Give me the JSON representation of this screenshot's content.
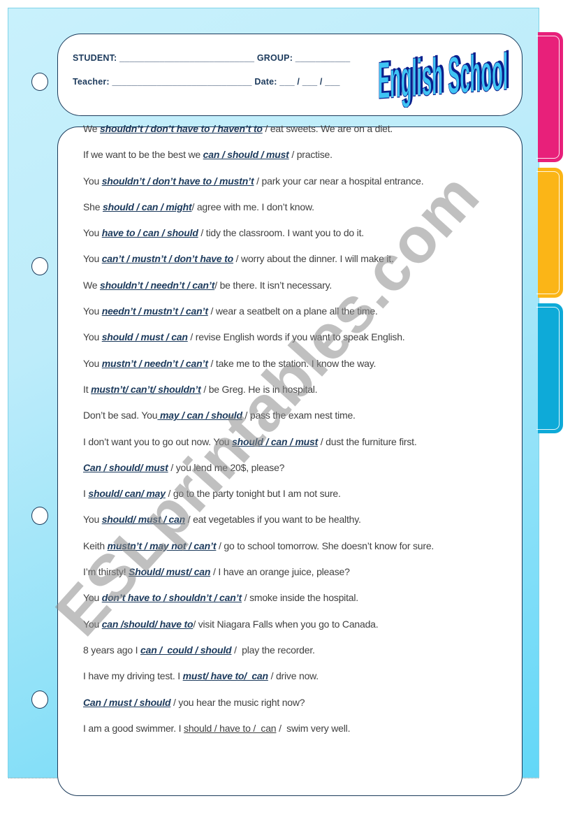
{
  "header": {
    "student_label": "STUDENT: ___________________________ GROUP: ___________",
    "teacher_label": "Teacher: ____________________________ Date: ___ / ___ / ___",
    "logo_text": "English School"
  },
  "exercises": [
    {
      "before": "We ",
      "choices": "shouldn’t / don’t have to / haven’t to",
      "after": " / eat sweets. We are on a diet."
    },
    {
      "before": "If we want to be the best we ",
      "choices": "can / should / must",
      "after": " / practise."
    },
    {
      "before": "You ",
      "choices": "shouldn’t / don’t have to / mustn’t",
      "after": " / park your car near a hospital entrance."
    },
    {
      "before": "She ",
      "choices": "should / can / might",
      "after": "/ agree with me. I don’t know."
    },
    {
      "before": "You ",
      "choices": "have to / can / should",
      "after": " / tidy the classroom. I want you to do it."
    },
    {
      "before": "You ",
      "choices": "can’t / mustn’t / don’t have to",
      "after": " / worry about the dinner. I will make it."
    },
    {
      "before": "We ",
      "choices": "shouldn’t / needn’t / can’t",
      "after": "/ be there. It isn’t necessary."
    },
    {
      "before": "You ",
      "choices": "needn’t / mustn’t / can’t",
      "after": " / wear a seatbelt on a plane all the time."
    },
    {
      "before": "You ",
      "choices": "should / must / can",
      "after": " / revise English words if you want to speak English."
    },
    {
      "before": "You ",
      "choices": "mustn’t / needn’t / can’t",
      "after": " / take me to the station. I know the way."
    },
    {
      "before": "It ",
      "choices": "mustn’t/ can’t/ shouldn’t",
      "after": " / be Greg. He is in hospital."
    },
    {
      "before": "Don’t be sad. You",
      "choices": " may / can / should",
      "after": " / pass the exam nest time."
    },
    {
      "before": "I don’t want you to go out now. You ",
      "choices": "should / can / must",
      "after": " / dust the furniture first."
    },
    {
      "before": "",
      "choices": "Can / should/ must",
      "after": " / you lend me 20$, please?"
    },
    {
      "before": "I ",
      "choices": "should/ can/ may",
      "after": " / go to the party tonight but I am not sure."
    },
    {
      "before": "You ",
      "choices": "should/ must / can",
      "after": " / eat vegetables if you want to be healthy."
    },
    {
      "before": "Keith ",
      "choices": "mustn’t / may not / can’t",
      "after": " / go to school tomorrow. She doesn’t know for sure."
    },
    {
      "before": "I’m thirsty! ",
      "choices": "Should/ must/ can",
      "after": " / I have an orange juice, please?"
    },
    {
      "before": "You ",
      "choices": "don’t have to / shouldn’t / can’t",
      "after": " / smoke inside the hospital."
    },
    {
      "before": "You ",
      "choices": "can /should/ have to",
      "after": "/ visit Niagara Falls when you go to Canada."
    },
    {
      "before": "8 years ago I ",
      "choices": "can /  could / should",
      "after": " /  play the recorder."
    },
    {
      "before": "I have my driving test. I ",
      "choices": "must/ have to/  can",
      "after": " / drive now."
    },
    {
      "before": "",
      "choices": "Can / must / should",
      "after": " / you hear the music right now?"
    },
    {
      "before": "I am a good swimmer. I ",
      "choices": "should / have to /  can",
      "after": " /  swim very well.",
      "plain": true
    }
  ],
  "watermark": "ESLprintables.com",
  "colors": {
    "tab_pink": "#e8207a",
    "tab_orange": "#fbb517",
    "tab_blue": "#0eaad8",
    "text_dark_blue": "#1c3a5c",
    "logo_light": "#3fc4f4",
    "logo_dark": "#0a1e8c"
  }
}
